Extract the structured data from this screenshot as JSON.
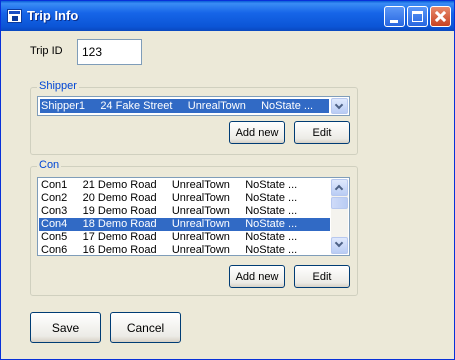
{
  "window": {
    "title": "Trip Info",
    "icon": "app-icon",
    "title_bar_colors": [
      "#0a5fd8",
      "#0b55d6"
    ]
  },
  "trip": {
    "label": "Trip ID",
    "value": "123"
  },
  "shipper": {
    "group_title": "Shipper",
    "selected": "Shipper1     24 Fake Street     UnrealTown     NoState ...",
    "add_new_label": "Add new",
    "edit_label": "Edit"
  },
  "con": {
    "group_title": "Con",
    "items": [
      "Con1     21 Demo Road     UnrealTown     NoState ...",
      "Con2     20 Demo Road     UnrealTown     NoState ...",
      "Con3     19 Demo Road     UnrealTown     NoState ...",
      "Con4     18 Demo Road     UnrealTown     NoState ...",
      "Con5     17 Demo Road     UnrealTown     NoState ...",
      "Con6     16 Demo Road     UnrealTown     NoState ..."
    ],
    "selected_index": 3,
    "add_new_label": "Add new",
    "edit_label": "Edit"
  },
  "actions": {
    "save_label": "Save",
    "cancel_label": "Cancel"
  },
  "colors": {
    "selection": "#316ac5",
    "group_title": "#0046d5",
    "window_bg": "#ece9d8"
  }
}
